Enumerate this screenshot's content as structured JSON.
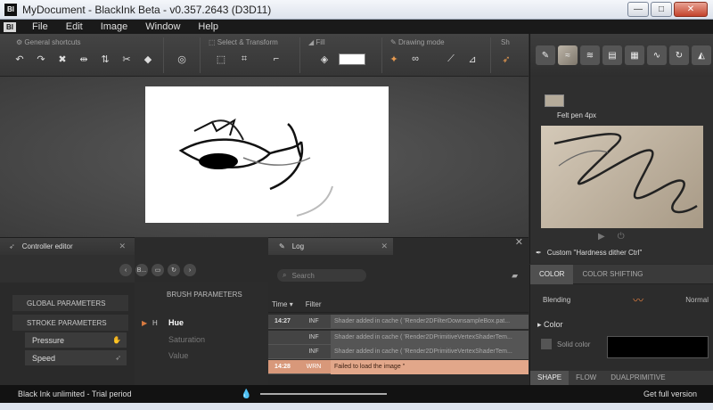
{
  "window": {
    "title": "MyDocument - BlackInk Beta - v0.357.2643 (D3D11)",
    "app_icon": "BI",
    "minimize": "—",
    "maximize": "□",
    "close": "✕"
  },
  "menu": {
    "logo": "BI",
    "items": [
      "File",
      "Edit",
      "Image",
      "Window",
      "Help"
    ]
  },
  "toolbar": {
    "general_label": "General shortcuts",
    "select_label": "Select & Transform",
    "fill_label": "Fill",
    "drawing_label": "Drawing mode",
    "cut_label": "Sh",
    "fill_color": "#ffffff"
  },
  "brush": {
    "name": "Felt pen 4px",
    "custom": "Custom \"Hardness dither Ctrl\""
  },
  "properties": {
    "tabs": [
      "COLOR",
      "COLOR SHIFTING"
    ],
    "blending_label": "Blending",
    "blending_value": "Normal",
    "color_label": "Color",
    "solid_label": "Solid color",
    "solid_color": "#000000",
    "shape_tabs": [
      "SHAPE",
      "FLOW",
      "DUALPRIMITIVE"
    ]
  },
  "controller": {
    "title": "Controller editor",
    "close": "✕",
    "global": "GLOBAL PARAMETERS",
    "stroke": "STROKE PARAMETERS",
    "params": [
      "Pressure",
      "Speed"
    ],
    "btn_b": "B..."
  },
  "brush_params": {
    "title": "BRUSH PARAMETERS",
    "items": [
      "Hue",
      "Saturation",
      "Value"
    ],
    "marker": "▶",
    "hue_icon": "H"
  },
  "log": {
    "title": "Log",
    "close": "✕",
    "panel_close": "✕",
    "search_placeholder": "Search",
    "col_time": "Time ▾",
    "col_filter": "Filter",
    "rows": [
      {
        "time": "14:27",
        "level": "INF",
        "msg": "Shader added in cache ( 'Render2DFilterDownsampleBox.pat..."
      },
      {
        "time": "",
        "level": "INF",
        "msg": "Shader added in cache ( 'Render2DPrimitiveVertexShaderTem..."
      },
      {
        "time": "",
        "level": "INF",
        "msg": "Shader added in cache ( 'Render2DPrimitiveVertexShaderTem..."
      },
      {
        "time": "14:28",
        "level": "WRN",
        "msg": "Failed to load the image ''"
      }
    ]
  },
  "status": {
    "trial": "Black Ink unlimited - Trial period",
    "full_version": "Get full version",
    "progress": 1.0
  }
}
